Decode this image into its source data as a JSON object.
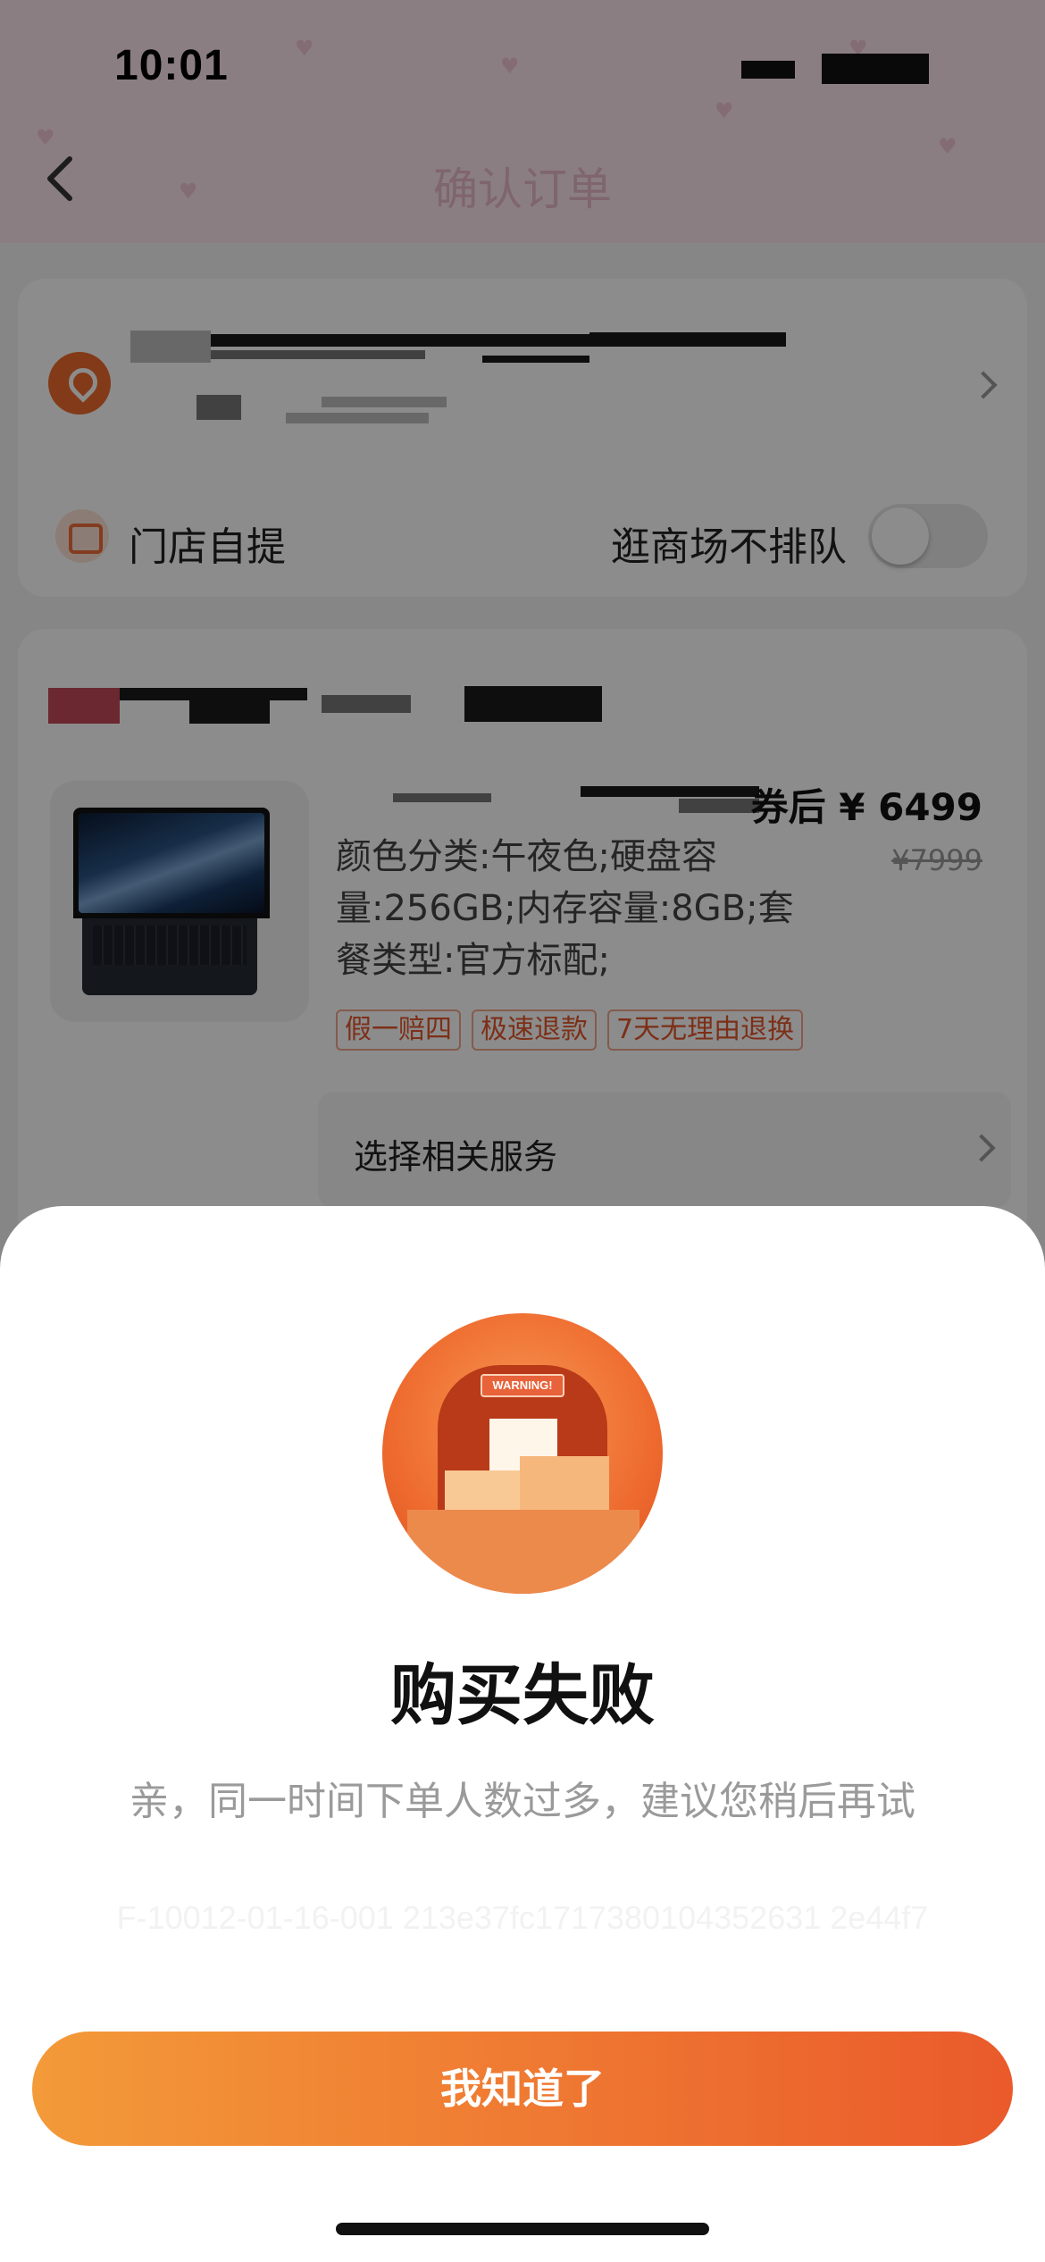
{
  "status_bar": {
    "time": "10:01"
  },
  "header": {
    "title": "确认订单"
  },
  "address_card": {
    "pickup_label": "门店自提",
    "queue_label": "逛商场不排队",
    "queue_toggle_on": false
  },
  "product": {
    "price_label": "券后 ¥ 6499",
    "original_price": "¥7999",
    "specs": "颜色分类:午夜色;硬盘容量:256GB;内存容量:8GB;套餐类型:官方标配;",
    "tags": [
      "假一赔四",
      "极速退款",
      "7天无理由退换"
    ],
    "service_label": "选择相关服务"
  },
  "sheet": {
    "illustration_sign": "WARNING!",
    "title": "购买失败",
    "message": "亲，同一时间下单人数过多，建议您稍后再试",
    "error_code": "F-10012-01-16-001 213e37fc1717380104352631 2e44f7",
    "confirm_label": "我知道了"
  },
  "colors": {
    "accent_start": "#f39a39",
    "accent_end": "#ea5a2b",
    "header_bg": "#fbe6ef",
    "tag_color": "#e4572a"
  }
}
